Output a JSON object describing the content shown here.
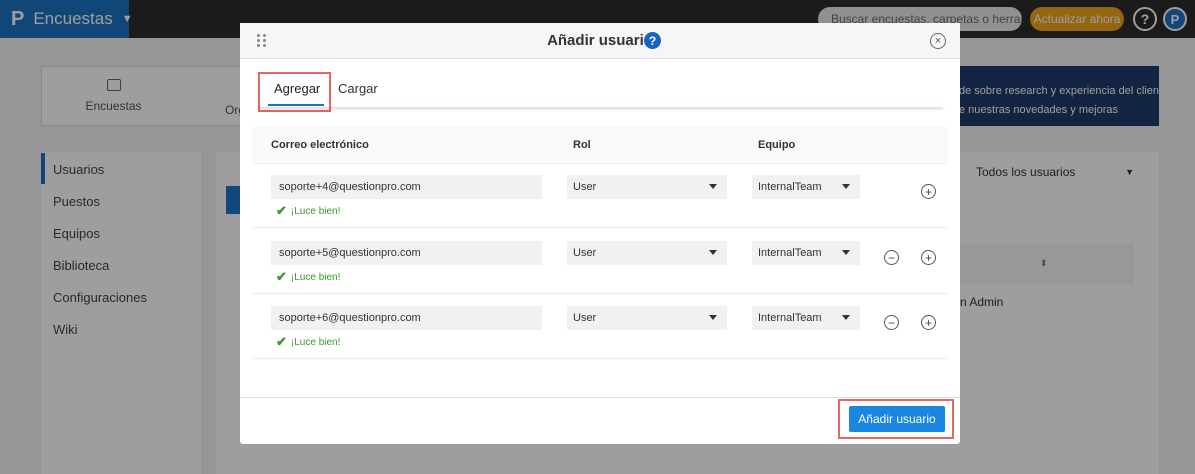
{
  "topbar": {
    "logo": "P",
    "app_title": "Encuestas",
    "search_placeholder": "Buscar encuestas, carpetas o herrami",
    "upgrade_label": "Actualizar ahora",
    "help_label": "?",
    "user_label": "P"
  },
  "background": {
    "surveys_tile": "Encuestas",
    "org_tab_fragment": "Org",
    "banner_line1": "de sobre research y experiencia del cliente",
    "banner_line2": "e nuestras novedades y mejoras",
    "sidebar": [
      "Usuarios",
      "Puestos",
      "Equipos",
      "Biblioteca",
      "Configuraciones",
      "Wiki"
    ],
    "filter_label": "Todos los usuarios",
    "admin_fragment": "n Admin"
  },
  "modal": {
    "title": "Añadir usuario",
    "help_label": "?",
    "close_label": "×",
    "tabs": [
      "Agregar",
      "Cargar"
    ],
    "columns": [
      "Correo electrónico",
      "Rol",
      "Equipo"
    ],
    "rows": [
      {
        "email": "soporte+4@questionpro.com",
        "status": "¡Luce bien!",
        "role": "User",
        "team": "InternalTeam"
      },
      {
        "email": "soporte+5@questionpro.com",
        "status": "¡Luce bien!",
        "role": "User",
        "team": "InternalTeam"
      },
      {
        "email": "soporte+6@questionpro.com",
        "status": "¡Luce bien!",
        "role": "User",
        "team": "InternalTeam"
      }
    ],
    "plus_label": "+",
    "minus_label": "−",
    "submit_label": "Añadir usuario"
  }
}
